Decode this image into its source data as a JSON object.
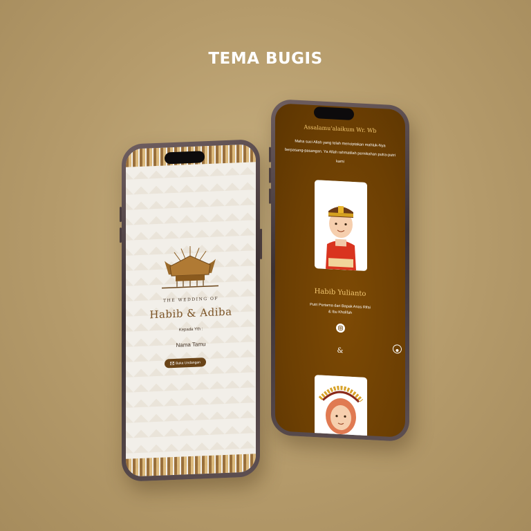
{
  "page": {
    "title": "TEMA BUGIS"
  },
  "left_phone": {
    "wedding_of": "THE WEDDING OF",
    "couple": "Habib & Adiba",
    "kepada": "Kepada Yth :",
    "guest": "Nama Tamu",
    "open_button": "Buka Undangan",
    "open_icon": "envelope-icon"
  },
  "right_phone": {
    "greeting": "Assalamu'alaikum Wr. Wb",
    "verse": "Maha suci Allah yang telah menciptakan mahluk-Nya berpasang-pasangan. Ya Allah rahmatilah pernikahan putra-putri kami",
    "groom_name": "Habib Yulianto",
    "parents_line1": "Putri Pertama dari Bapak Anas Rifai",
    "parents_line2": "& Ibu Kholifah",
    "ampersand": "&",
    "instagram_icon": "instagram-icon",
    "music_icon": "music-disc-icon"
  },
  "colors": {
    "background": "#b59b6b",
    "accent_brown": "#6c3f03",
    "gold": "#f3c872",
    "button": "#6a4418"
  }
}
